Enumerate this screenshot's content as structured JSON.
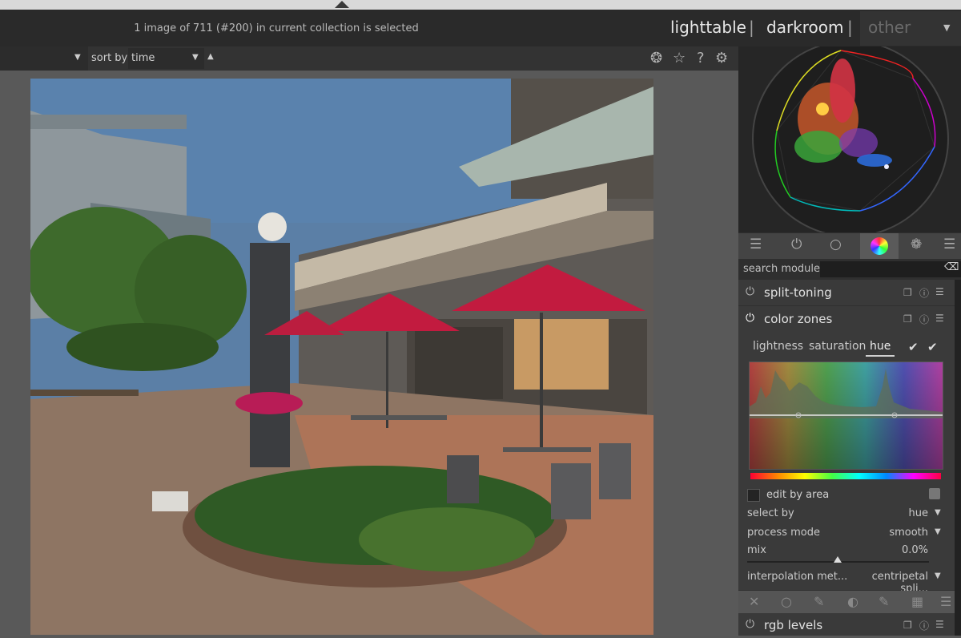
{
  "header": {
    "status": "1 image of 711 (#200) in current collection is selected",
    "views": {
      "lighttable": "lighttable",
      "darkroom": "darkroom",
      "other": "other"
    },
    "separator": "|"
  },
  "toolbar": {
    "sort_label": "sort by",
    "sort_value": "time"
  },
  "right": {
    "search_label": "search module",
    "modules": {
      "split_toning": "split-toning",
      "color_zones": "color zones",
      "rgb_levels": "rgb levels"
    },
    "color_zones": {
      "tabs": [
        "lightness",
        "saturation",
        "hue"
      ],
      "active_tab": "hue",
      "edit_by_area": "edit by area",
      "select_by_label": "select by",
      "select_by_value": "hue",
      "process_mode_label": "process mode",
      "process_mode_value": "smooth",
      "mix_label": "mix",
      "mix_value": "0.0%",
      "interp_label": "interpolation met...",
      "interp_value": "centripetal spli..."
    }
  },
  "icons": {
    "toolbar": [
      "grouping-icon",
      "star-icon",
      "help-icon",
      "gear-icon"
    ],
    "modules": [
      "sliders-icon",
      "power-icon",
      "circle-icon",
      "color-wheel-icon",
      "aperture-icon",
      "menu-icon"
    ],
    "blend": [
      "close-icon",
      "circle-icon",
      "brush-icon",
      "parametric-mask-icon",
      "drawn-parametric-icon",
      "raster-mask-icon",
      "menu-icon"
    ]
  },
  "colors": {
    "accent": "#e6e6e6",
    "panel": "#3a3a3a",
    "background": "#595959"
  }
}
